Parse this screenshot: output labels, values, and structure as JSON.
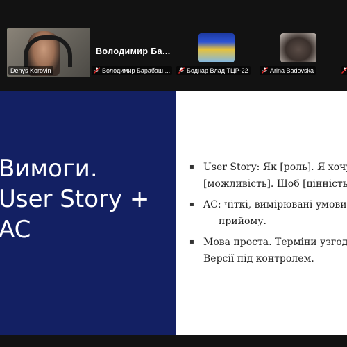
{
  "participants": [
    {
      "name": "Denys Korovin",
      "muted": false
    },
    {
      "name": "Володимир Барабаш ...",
      "center_name": "Володимир  Ба...",
      "muted": true
    },
    {
      "name": "Боднар Влад ТЦР-22",
      "muted": true
    },
    {
      "name": "Arina Badovska",
      "muted": true
    }
  ],
  "slide": {
    "title_lines": [
      "Вимоги.",
      "User Story +",
      "AC"
    ],
    "bullets": [
      {
        "line1": "User Story: Як [роль]. Я хочу",
        "line2": "[можливість]. Щоб [цінність]."
      },
      {
        "line1": "AC: чіткі, вимірювані умови",
        "line2": "прийому."
      },
      {
        "line1": "Мова проста. Терміни узгодж",
        "line2": "Версії під контролем."
      }
    ]
  },
  "colors": {
    "active_speaker": "#2ad44a",
    "slide_left_bg": "#132063",
    "mute": "#e02828"
  },
  "icons": {
    "mute": "mic-off-icon"
  }
}
